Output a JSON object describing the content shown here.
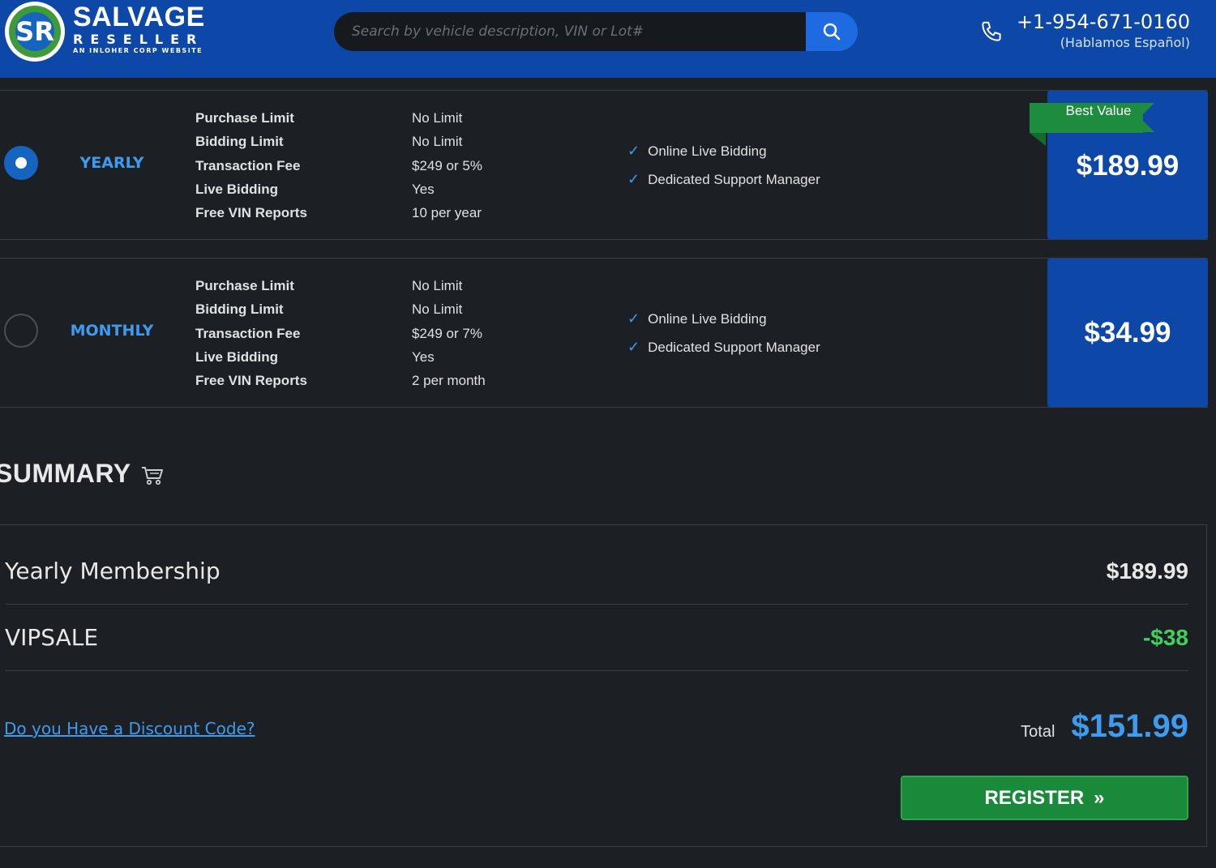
{
  "header": {
    "logo_initials": "SR",
    "logo_title": "SALVAGE",
    "logo_subtitle": "RESELLER",
    "logo_tagline": "AN INLOHER CORP WEBSITE",
    "search_placeholder": "Search by vehicle description, VIN or Lot#",
    "phone_number": "+1-954-671-0160",
    "phone_note": "(Hablamos Español)"
  },
  "plans": [
    {
      "name": "YEARLY",
      "selected": true,
      "badge": "Best Value",
      "price": "$189.99",
      "features": [
        {
          "label": "Purchase Limit",
          "value": "No Limit"
        },
        {
          "label": "Bidding Limit",
          "value": "No Limit"
        },
        {
          "label": "Transaction Fee",
          "value": "$249 or 5%"
        },
        {
          "label": "Live Bidding",
          "value": "Yes"
        },
        {
          "label": "Free VIN Reports",
          "value": "10 per year"
        }
      ],
      "perks": [
        "Online Live Bidding",
        "Dedicated Support Manager"
      ]
    },
    {
      "name": "MONTHLY",
      "selected": false,
      "price": "$34.99",
      "features": [
        {
          "label": "Purchase Limit",
          "value": "No Limit"
        },
        {
          "label": "Bidding Limit",
          "value": "No Limit"
        },
        {
          "label": "Transaction Fee",
          "value": "$249 or 7%"
        },
        {
          "label": "Live Bidding",
          "value": "Yes"
        },
        {
          "label": "Free VIN Reports",
          "value": "2 per month"
        }
      ],
      "perks": [
        "Online Live Bidding",
        "Dedicated Support Manager"
      ]
    }
  ],
  "summary": {
    "title": "SUMMARY",
    "icon": "cart-icon",
    "lines": [
      {
        "name": "Yearly Membership",
        "price": "$189.99"
      },
      {
        "name": "VIPSALE",
        "price": "-$38"
      }
    ],
    "discount_link": "Do you Have a Discount Code?",
    "total_label": "Total",
    "total_value": "$151.99",
    "register_label": "REGISTER"
  },
  "colors": {
    "header_bg": "#0d47a8",
    "page_bg": "#1c1f23",
    "accent_blue": "#3d9bf0",
    "discount_green": "#3fd15c",
    "register_green": "#1a8a3a",
    "ribbon_green": "#1e8c3e"
  }
}
